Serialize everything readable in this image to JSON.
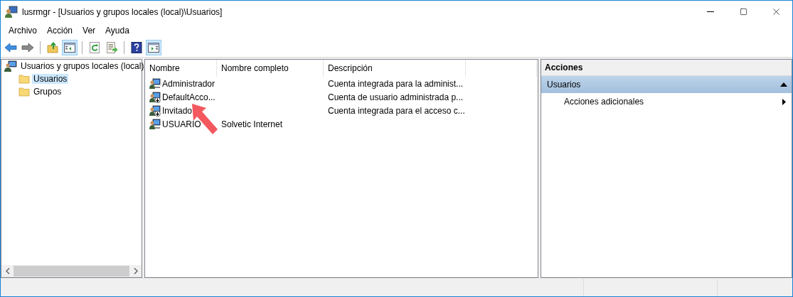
{
  "window": {
    "title": "lusrmgr - [Usuarios y grupos locales (local)\\Usuarios]"
  },
  "menu": [
    "Archivo",
    "Acción",
    "Ver",
    "Ayuda"
  ],
  "toolbar": [
    [
      {
        "kind": "back",
        "selected": false
      },
      {
        "kind": "forward",
        "selected": false
      }
    ],
    [
      {
        "kind": "up",
        "selected": false
      },
      {
        "kind": "tree",
        "selected": true
      }
    ],
    [
      {
        "kind": "refresh",
        "selected": false
      },
      {
        "kind": "export",
        "selected": false
      }
    ],
    [
      {
        "kind": "help",
        "selected": false
      },
      {
        "kind": "actionpane",
        "selected": true
      }
    ]
  ],
  "tree": {
    "label": "Usuarios y grupos locales (local)",
    "children": [
      {
        "label": "Usuarios",
        "selected": true
      },
      {
        "label": "Grupos",
        "selected": false
      }
    ]
  },
  "table": {
    "columns": [
      "Nombre",
      "Nombre completo",
      "Descripción"
    ],
    "rows": [
      {
        "name": "Administrador",
        "full_name": "",
        "description": "Cuenta integrada para la administ...",
        "disabled": false
      },
      {
        "name": "DefaultAcco...",
        "full_name": "",
        "description": "Cuenta de usuario administrada p...",
        "disabled": true
      },
      {
        "name": "Invitado",
        "full_name": "",
        "description": "Cuenta integrada para el acceso c...",
        "disabled": true
      },
      {
        "name": "USUARIO",
        "full_name": "Solvetic Internet",
        "description": "",
        "disabled": false
      }
    ]
  },
  "actions": {
    "title": "Acciones",
    "section": {
      "label": "Usuarios",
      "expanded": true
    },
    "items": [
      "Acciones adicionales"
    ]
  }
}
